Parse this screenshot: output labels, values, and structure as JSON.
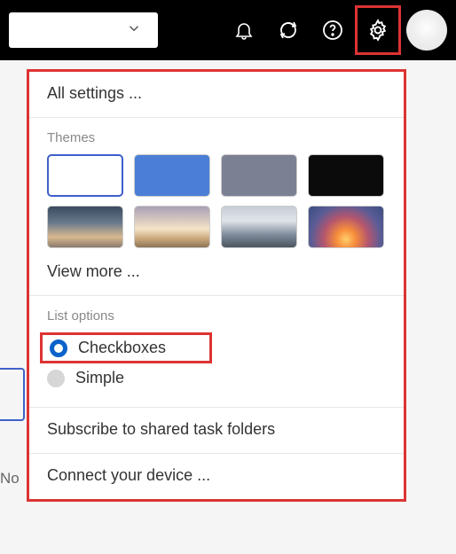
{
  "topbar": {
    "icons": {
      "chevron": "chevron-down-icon",
      "bell": "bell-icon",
      "sync": "sync-icon",
      "help": "help-icon",
      "settings": "gear-icon",
      "avatar": "avatar"
    }
  },
  "panel": {
    "all_settings": "All settings ...",
    "themes_label": "Themes",
    "themes": [
      {
        "name": "white"
      },
      {
        "name": "blue"
      },
      {
        "name": "gray"
      },
      {
        "name": "black"
      },
      {
        "name": "mountain"
      },
      {
        "name": "beach"
      },
      {
        "name": "city"
      },
      {
        "name": "sunset"
      }
    ],
    "view_more": "View more ...",
    "list_options_label": "List options",
    "list_options": {
      "checkboxes": "Checkboxes",
      "simple": "Simple",
      "selected": "checkboxes"
    },
    "subscribe": "Subscribe to shared task folders",
    "connect": "Connect your device ..."
  },
  "background": {
    "no_text": "No"
  }
}
